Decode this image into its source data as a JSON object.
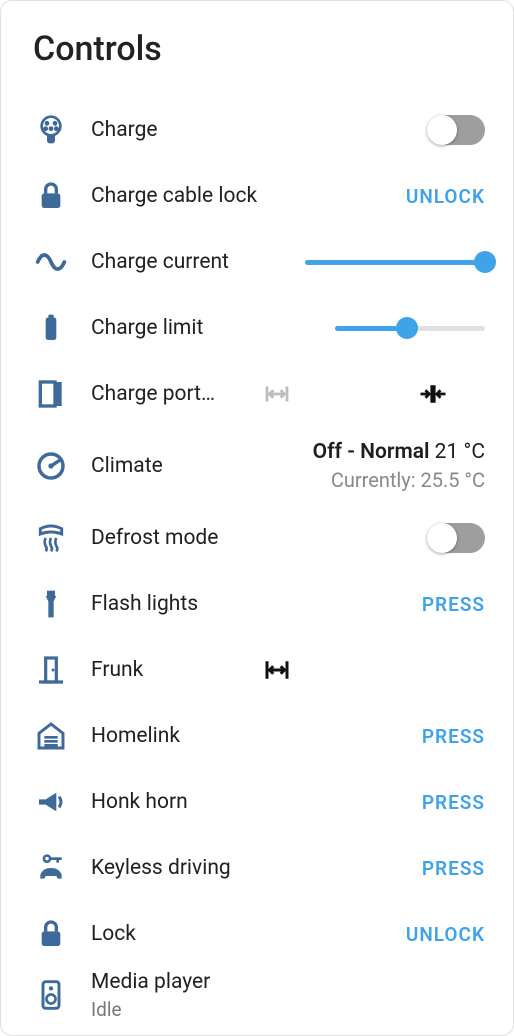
{
  "title": "Controls",
  "charge": {
    "label": "Charge",
    "on": false
  },
  "cable_lock": {
    "label": "Charge cable lock",
    "action": "UNLOCK"
  },
  "charge_current": {
    "label": "Charge current",
    "pct": 100
  },
  "charge_limit": {
    "label": "Charge limit",
    "pct": 48
  },
  "charge_port": {
    "label": "Charge port…",
    "open_enabled": false,
    "close_enabled": true
  },
  "climate": {
    "label": "Climate",
    "state": "Off",
    "preset": "Normal",
    "set_temp": "21 °C",
    "current": "Currently: 25.5 °C"
  },
  "defrost": {
    "label": "Defrost mode",
    "on": false
  },
  "flash": {
    "label": "Flash lights",
    "action": "PRESS"
  },
  "frunk": {
    "label": "Frunk"
  },
  "homelink": {
    "label": "Homelink",
    "action": "PRESS"
  },
  "horn": {
    "label": "Honk horn",
    "action": "PRESS"
  },
  "keyless": {
    "label": "Keyless driving",
    "action": "PRESS"
  },
  "lock": {
    "label": "Lock",
    "action": "UNLOCK"
  },
  "media": {
    "label": "Media player",
    "status": "Idle"
  }
}
